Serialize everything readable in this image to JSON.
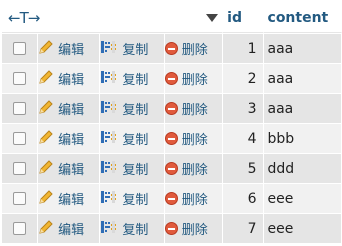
{
  "header": {
    "arrows": "←T→",
    "col_id": "id",
    "col_content": "content"
  },
  "actions": {
    "edit": "编辑",
    "copy": "复制",
    "delete": "删除"
  },
  "rows": [
    {
      "id": "1",
      "content": "aaa"
    },
    {
      "id": "2",
      "content": "aaa"
    },
    {
      "id": "3",
      "content": "aaa"
    },
    {
      "id": "4",
      "content": "bbb"
    },
    {
      "id": "5",
      "content": "ddd"
    },
    {
      "id": "6",
      "content": "eee"
    },
    {
      "id": "7",
      "content": "eee"
    }
  ],
  "icons": {
    "edit": "pencil-icon",
    "copy": "copy-icon",
    "delete": "delete-icon",
    "sort": "sort-triangle-icon"
  },
  "colors": {
    "link": "#235a81",
    "row_odd": "#e5e5e5",
    "row_even": "#f1f1f1",
    "delete_icon": "#e05a3c"
  }
}
